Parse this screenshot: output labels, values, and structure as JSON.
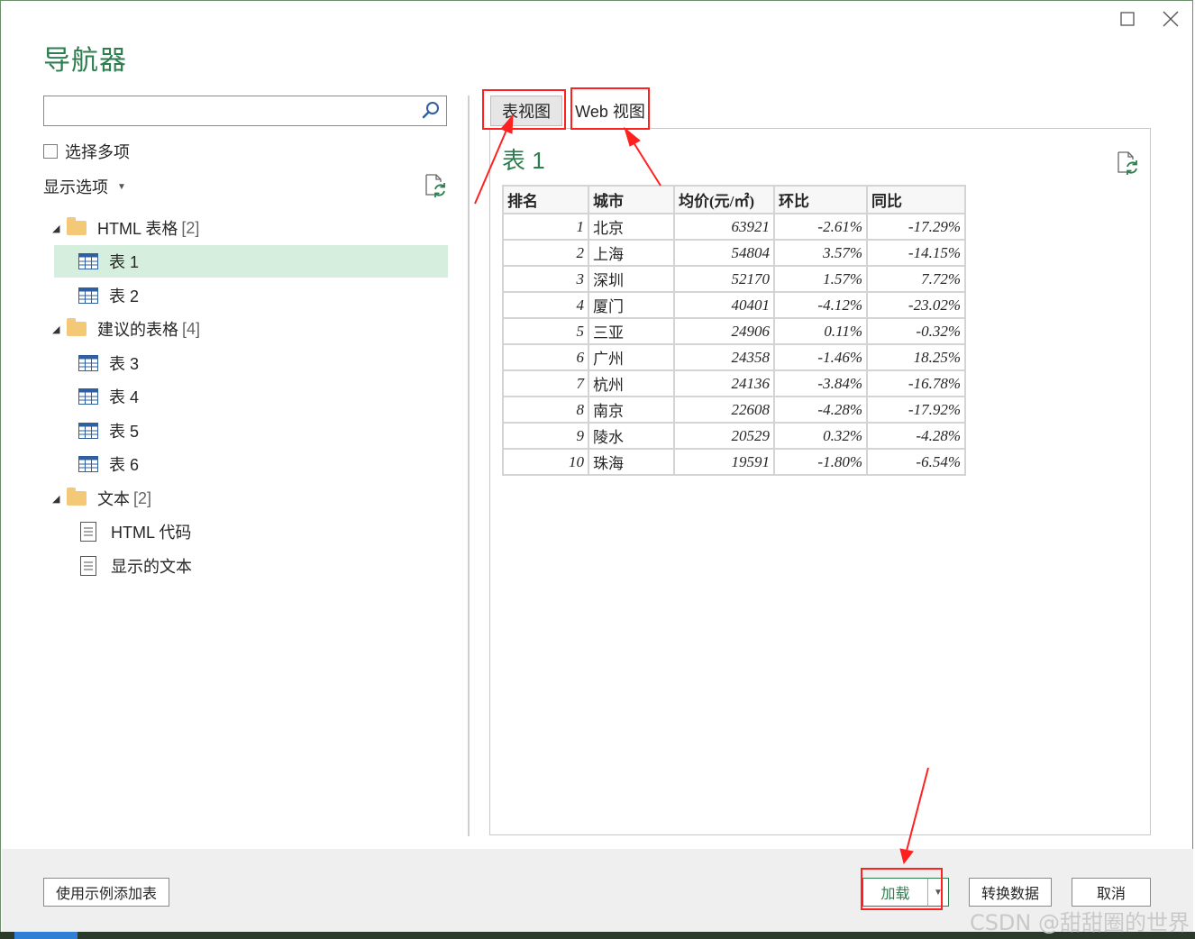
{
  "dialog": {
    "title": "导航器",
    "maximize_icon": "maximize-icon",
    "close_icon": "close-icon"
  },
  "sidebar": {
    "search": {
      "value": "",
      "placeholder": ""
    },
    "select_multiple_label": "选择多项",
    "display_options_label": "显示选项",
    "tree": [
      {
        "type": "folder",
        "label": "HTML 表格",
        "count": "[2]"
      },
      {
        "type": "table",
        "label": "表 1",
        "selected": true
      },
      {
        "type": "table",
        "label": "表 2"
      },
      {
        "type": "folder",
        "label": "建议的表格",
        "count": "[4]"
      },
      {
        "type": "table",
        "label": "表 3"
      },
      {
        "type": "table",
        "label": "表 4"
      },
      {
        "type": "table",
        "label": "表 5"
      },
      {
        "type": "table",
        "label": "表 6"
      },
      {
        "type": "folder",
        "label": "文本",
        "count": "[2]"
      },
      {
        "type": "text",
        "label": "HTML 代码"
      },
      {
        "type": "text",
        "label": "显示的文本"
      }
    ]
  },
  "preview": {
    "tabs": [
      "表视图",
      "Web 视图"
    ],
    "title": "表 1",
    "columns": [
      "排名",
      "城市",
      "均价(元/㎡)",
      "环比",
      "同比"
    ],
    "rows": [
      [
        "1",
        "北京",
        "63921",
        "-2.61%",
        "-17.29%"
      ],
      [
        "2",
        "上海",
        "54804",
        "3.57%",
        "-14.15%"
      ],
      [
        "3",
        "深圳",
        "52170",
        "1.57%",
        "7.72%"
      ],
      [
        "4",
        "厦门",
        "40401",
        "-4.12%",
        "-23.02%"
      ],
      [
        "5",
        "三亚",
        "24906",
        "0.11%",
        "-0.32%"
      ],
      [
        "6",
        "广州",
        "24358",
        "-1.46%",
        "18.25%"
      ],
      [
        "7",
        "杭州",
        "24136",
        "-3.84%",
        "-16.78%"
      ],
      [
        "8",
        "南京",
        "22608",
        "-4.28%",
        "-17.92%"
      ],
      [
        "9",
        "陵水",
        "20529",
        "0.32%",
        "-4.28%"
      ],
      [
        "10",
        "珠海",
        "19591",
        "-1.80%",
        "-6.54%"
      ]
    ]
  },
  "footer": {
    "add_from_examples": "使用示例添加表",
    "load": "加载",
    "transform": "转换数据",
    "cancel": "取消"
  },
  "watermark": "CSDN @甜甜圈的世界",
  "colors": {
    "accent": "#2e7d4f",
    "selection": "#d5eedd",
    "annotation": "#ff2020"
  }
}
